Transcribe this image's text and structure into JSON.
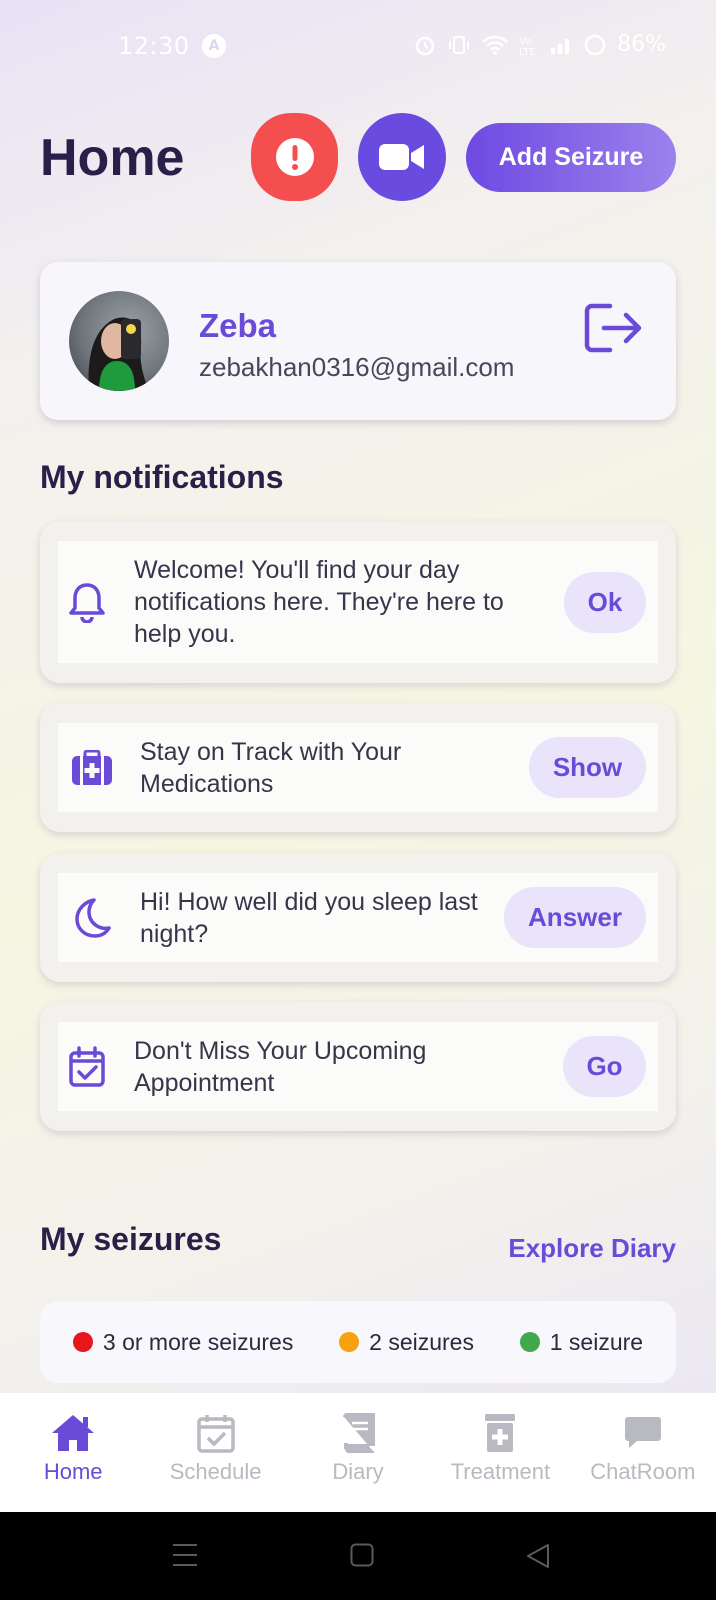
{
  "status_bar": {
    "time": "12:30",
    "alert_glyph": "A",
    "battery": "86%"
  },
  "header": {
    "title": "Home",
    "sos_icon": "exclamation-icon",
    "video_icon": "video-camera-icon",
    "add_seizure_label": "Add Seizure"
  },
  "profile": {
    "name": "Zeba",
    "email": "zebakhan0316@gmail.com"
  },
  "notifications": {
    "title": "My notifications",
    "items": [
      {
        "icon": "bell-icon",
        "text": "Welcome! You'll find your day notifications here. They're here to help you.",
        "action": "Ok"
      },
      {
        "icon": "medkit-icon",
        "text": "Stay on Track with Your Medications",
        "action": "Show"
      },
      {
        "icon": "moon-icon",
        "text": "Hi! How well did you sleep last night?",
        "action": "Answer"
      },
      {
        "icon": "calendar-check-icon",
        "text": "Don't Miss Your Upcoming Appointment",
        "action": "Go"
      }
    ]
  },
  "seizures": {
    "title": "My seizures",
    "explore_label": "Explore Diary",
    "legend": [
      {
        "label": "3 or more seizures",
        "color": "#e8151b"
      },
      {
        "label": "2 seizures",
        "color": "#f6a10d"
      },
      {
        "label": "1 seizure",
        "color": "#41a84b"
      }
    ]
  },
  "bottom_nav": {
    "items": [
      {
        "label": "Home",
        "icon": "home-icon",
        "active": true
      },
      {
        "label": "Schedule",
        "icon": "calendar-icon",
        "active": false
      },
      {
        "label": "Diary",
        "icon": "book-icon",
        "active": false
      },
      {
        "label": "Treatment",
        "icon": "medicine-icon",
        "active": false
      },
      {
        "label": "ChatRoom",
        "icon": "chat-icon",
        "active": false
      }
    ]
  },
  "colors": {
    "accent": "#6a4bd8",
    "sos": "#f44e4e",
    "text_dark": "#2b1f4a"
  }
}
